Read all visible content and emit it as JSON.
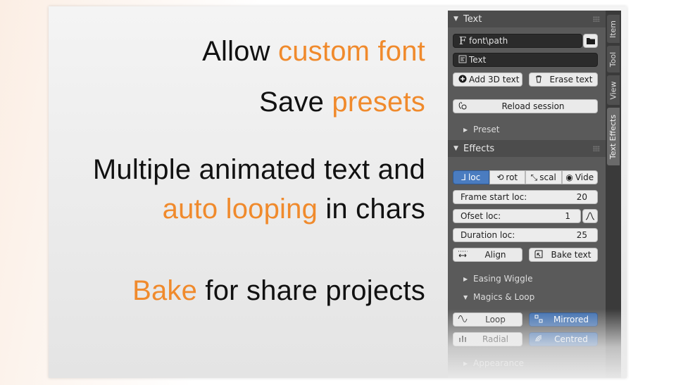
{
  "slogans": {
    "line1_pre": "Allow ",
    "line1_hl": "custom font",
    "line2_pre": "Save ",
    "line2_hl": "presets",
    "line3": "Multiple animated text and",
    "line4_hl": "auto looping",
    "line4_post": " in chars",
    "line5_hl": "Bake",
    "line5_post": " for share projects"
  },
  "colors": {
    "accent": "#f08a2c",
    "panel_bg": "#5a5a5a",
    "active_blue": "#4a7cc0"
  },
  "panel": {
    "text_section": {
      "title": "Text",
      "font_path": "font\\path",
      "text_field": "Text",
      "add_3d_text": "Add 3D text",
      "erase_text": "Erase text",
      "reload_session": "Reload session",
      "preset_label": "Preset"
    },
    "effects_section": {
      "title": "Effects",
      "modes": [
        "loc",
        "rot",
        "scal",
        "Vide"
      ],
      "active_mode": "loc",
      "frame_start_label": "Frame start loc:",
      "frame_start_value": "20",
      "offset_label": "Ofset loc:",
      "offset_value": "1",
      "duration_label": "Duration loc:",
      "duration_value": "25",
      "align": "Align",
      "bake_text": "Bake text",
      "easing_wiggle": "Easing Wiggle",
      "magics_loop": "Magics & Loop",
      "loop": "Loop",
      "mirrored": "Mirrored",
      "radial": "Radial",
      "centred": "Centred",
      "appearance": "Appearance"
    },
    "tabs": [
      "Item",
      "Tool",
      "View",
      "Text Effects"
    ],
    "active_tab": "Text Effects"
  },
  "icons": {
    "font": "font-f-icon",
    "folder": "folder-icon",
    "text": "text-block-icon",
    "add": "plus-circle-icon",
    "trash": "trash-icon",
    "reload": "reload-session-icon",
    "align": "align-icon",
    "bake": "bake-icon",
    "curve": "curve-icon",
    "loop": "loop-wave-icon",
    "mirrored": "mirrored-icon",
    "radial": "radial-bars-icon",
    "centred": "centred-icon"
  }
}
